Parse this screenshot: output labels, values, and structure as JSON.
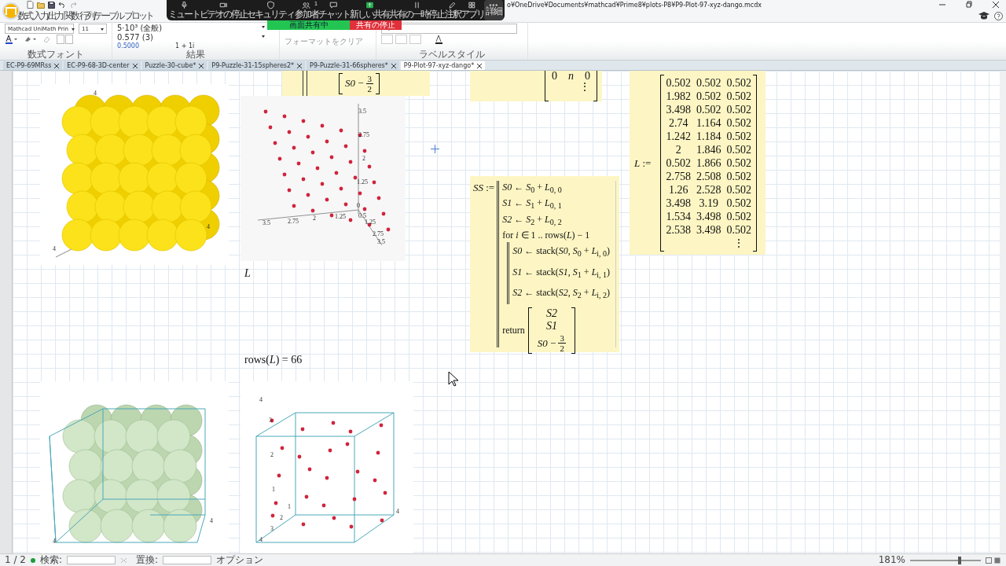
{
  "title_bar": {
    "path": "o¥OneDrive¥Documents¥mathcad¥Prime8¥plots-P8¥P9-Plot-97-xyz-dango.mcdx"
  },
  "meeting_toolbar": {
    "buttons": [
      {
        "label": "ミュート"
      },
      {
        "label": "ビデオの停止"
      },
      {
        "label": "セキュリティ"
      },
      {
        "label": "参加者",
        "badge": "1"
      },
      {
        "label": "チャット"
      },
      {
        "label": "新しい共有"
      },
      {
        "label": "共有の一時停止"
      },
      {
        "label": "注釈"
      },
      {
        "label": "アプリ"
      },
      {
        "label": "詳細"
      }
    ]
  },
  "share_bar": {
    "status": "画面共有中",
    "stop": "共有の停止"
  },
  "ribbon": {
    "tabs": [
      {
        "label": "数式",
        "selected": false
      },
      {
        "label": "入力/出力",
        "selected": false
      },
      {
        "label": "関数",
        "selected": false
      },
      {
        "label": "行列/テーブル",
        "selected": false
      },
      {
        "label": "プロット",
        "selected": false
      }
    ],
    "font": "Mathcad UniMath Prin",
    "size": "11",
    "result_format": "5·10³ (全般)",
    "precision": "0.577 (3)",
    "tolerance": "0.5000",
    "complex": "1 + 1i",
    "clear_format": "フォーマットをクリア",
    "groups": [
      "数式フォント",
      "結果",
      "ラベルスタイル"
    ]
  },
  "doc_tabs": [
    {
      "label": "EC-P9-69MRss",
      "selected": false
    },
    {
      "label": "EC-P9-68-3D-center",
      "selected": false
    },
    {
      "label": "Puzzle-30-cube*",
      "selected": false
    },
    {
      "label": "P9-Puzzle-31-15spheres2*",
      "selected": false
    },
    {
      "label": "P9-Puzzle-31-66spheres*",
      "selected": false
    },
    {
      "label": "P9-Plot-97-xyz-dango*",
      "selected": true
    }
  ],
  "worksheet": {
    "top_regions": [
      {
        "frac": {
          "lead": "*S0* −",
          "num": "3",
          "den": "2"
        }
      },
      {
        "row": [
          "0",
          "*n*",
          "0"
        ],
        "more": "⋮"
      }
    ],
    "plot_spheres": {
      "ticks": [
        "4",
        "4",
        "4"
      ]
    },
    "plot_points": {
      "ticks": [
        "3.5",
        "2.75",
        "2",
        "1.25",
        "0",
        "3.5",
        "2.75",
        "2",
        "1.25",
        "0.5",
        "1.25",
        "2.75",
        "3.5"
      ]
    },
    "label_L": "L",
    "program": {
      "name": "*SS*",
      "op": ":=",
      "lines": [
        "*S0* ← *S*$_{0}$ + *L*$_{0, 0}$",
        "*S1* ← *S*$_{1}$ + *L*$_{0, 1}$",
        "*S2* ← *S*$_{2}$ + *L*$_{0, 2}$"
      ],
      "for_head": "for *i* ∈ 1 .. rows(*L*) − 1",
      "for_body": [
        "*S0* ← stack(*S0*, *S*$_{0}$ + *L*$_{i, 0}$)",
        "*S1* ← stack(*S1*, *S*$_{1}$ + *L*$_{i, 1}$)",
        "*S2* ← stack(*S2*, *S*$_{2}$ + *L*$_{i, 2}$)"
      ],
      "return_kw": "return",
      "return_items": [
        "*S2*",
        "*S1*"
      ],
      "return_frac": {
        "lead": "*S0* −",
        "num": "3",
        "den": "2"
      }
    },
    "matrix_L": {
      "name": "*L* :=",
      "rows": [
        [
          "0.502",
          "0.502",
          "0.502"
        ],
        [
          "1.982",
          "0.502",
          "0.502"
        ],
        [
          "3.498",
          "0.502",
          "0.502"
        ],
        [
          "2.74",
          "1.164",
          "0.502"
        ],
        [
          "1.242",
          "1.184",
          "0.502"
        ],
        [
          "2",
          "1.846",
          "0.502"
        ],
        [
          "0.502",
          "1.866",
          "0.502"
        ],
        [
          "2.758",
          "2.508",
          "0.502"
        ],
        [
          "1.26",
          "2.528",
          "0.502"
        ],
        [
          "3.498",
          "3.19",
          "0.502"
        ],
        [
          "1.534",
          "3.498",
          "0.502"
        ],
        [
          "2.538",
          "3.498",
          "0.502"
        ]
      ],
      "more": "⋮"
    },
    "rows_result": "rows(*L*) = 66",
    "plot_spheres_box": {
      "ticks": [
        "4",
        "4"
      ]
    },
    "plot_points_box": {
      "ticks": [
        "4",
        "3",
        "2",
        "1",
        "4",
        "3",
        "2",
        "1",
        "4"
      ]
    }
  },
  "status_bar": {
    "page": "1 / 2",
    "search": "検索:",
    "replace": "置換:",
    "options": "オプション",
    "zoom": "181%",
    "zoom_slider": {
      "level": 0.68
    }
  }
}
